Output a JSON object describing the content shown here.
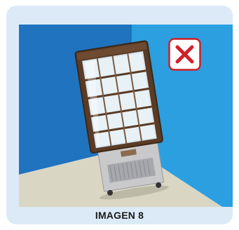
{
  "colors": {
    "card_background": "#dbeaf6",
    "wall_left": "#1f73bf",
    "wall_right": "#2b9fe0",
    "floor": "#d9d6c4",
    "badge_border": "#cf1f25",
    "badge_x": "#d3202a"
  },
  "icons": {
    "status": "red-x-icon",
    "illustration": "tilted-display-refrigerator"
  },
  "caption": "IMAGEN 8"
}
